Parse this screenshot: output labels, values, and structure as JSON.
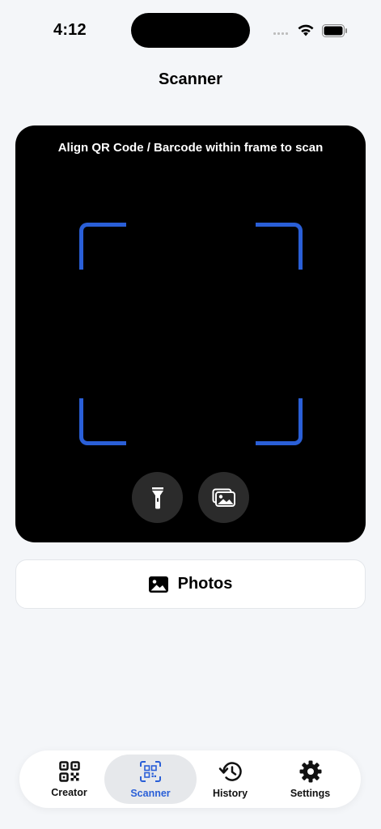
{
  "status_bar": {
    "time": "4:12",
    "icons": [
      "cellular-signal-icon",
      "wifi-icon",
      "battery-icon"
    ]
  },
  "nav": {
    "title": "Scanner"
  },
  "camera": {
    "hint": "Align QR Code / Barcode within frame to scan",
    "frame_color": "#2a5fd7",
    "buttons": [
      {
        "icon": "flashlight-icon"
      },
      {
        "icon": "photo-gallery-icon"
      }
    ]
  },
  "photos_button": {
    "label": "Photos",
    "icon": "photo-icon"
  },
  "tab_bar": {
    "accent": "#2a5fd7",
    "tabs": [
      {
        "label": "Creator",
        "icon": "qr-code-icon",
        "active": false
      },
      {
        "label": "Scanner",
        "icon": "qr-scan-icon",
        "active": true
      },
      {
        "label": "History",
        "icon": "history-icon",
        "active": false
      },
      {
        "label": "Settings",
        "icon": "gear-icon",
        "active": false
      }
    ]
  }
}
